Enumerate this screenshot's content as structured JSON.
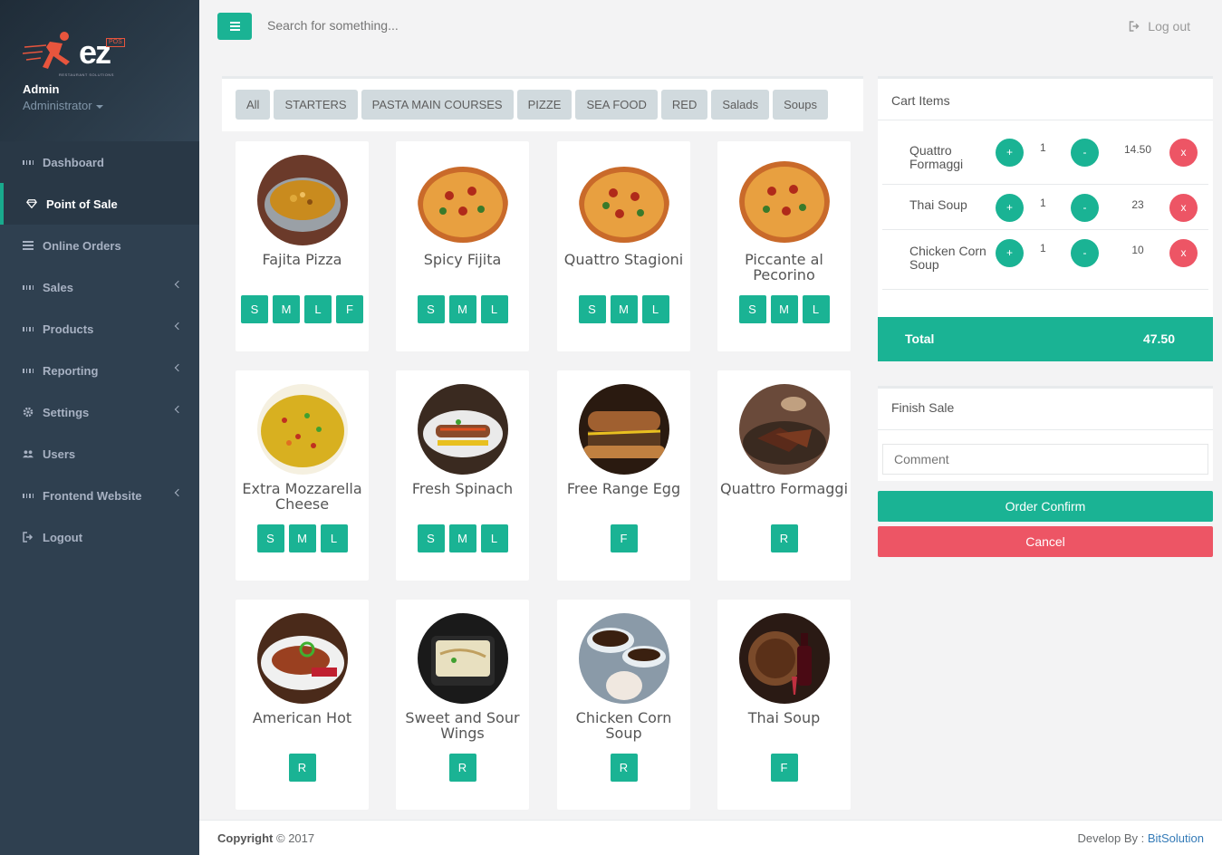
{
  "brand": {
    "logo_text": "ez",
    "logo_badge": "POS",
    "logo_tagline": "RESTAURANT SOLUTIONS"
  },
  "profile": {
    "name": "Admin",
    "role": "Administrator"
  },
  "sidebar": {
    "items": [
      {
        "label": "Dashboard",
        "icon": "grid-icon"
      },
      {
        "label": "Point of Sale",
        "icon": "diamond-icon"
      },
      {
        "label": "Online Orders",
        "icon": "list-icon"
      },
      {
        "label": "Sales",
        "icon": "grid-icon"
      },
      {
        "label": "Products",
        "icon": "grid-icon"
      },
      {
        "label": "Reporting",
        "icon": "grid-icon"
      },
      {
        "label": "Settings",
        "icon": "gear-icon"
      },
      {
        "label": "Users",
        "icon": "users-icon"
      },
      {
        "label": "Frontend Website",
        "icon": "grid-icon"
      },
      {
        "label": "Logout",
        "icon": "sign-out-icon"
      }
    ]
  },
  "topbar": {
    "search_placeholder": "Search for something...",
    "logout_label": "Log out"
  },
  "categories": [
    "All",
    "STARTERS",
    "PASTA MAIN COURSES",
    "PIZZE",
    "SEA FOOD",
    "RED",
    "Salads",
    "Soups"
  ],
  "products": [
    {
      "name": "Fajita Pizza",
      "sizes": [
        "S",
        "M",
        "L",
        "F"
      ]
    },
    {
      "name": "Spicy Fijita",
      "sizes": [
        "S",
        "M",
        "L"
      ]
    },
    {
      "name": "Quattro Stagioni",
      "sizes": [
        "S",
        "M",
        "L"
      ]
    },
    {
      "name": "Piccante al Pecorino",
      "sizes": [
        "S",
        "M",
        "L"
      ]
    },
    {
      "name": "Extra Mozzarella Cheese",
      "sizes": [
        "S",
        "M",
        "L"
      ]
    },
    {
      "name": "Fresh Spinach",
      "sizes": [
        "S",
        "M",
        "L"
      ]
    },
    {
      "name": "Free Range Egg",
      "sizes": [
        "F"
      ]
    },
    {
      "name": "Quattro Formaggi",
      "sizes": [
        "R"
      ]
    },
    {
      "name": "American Hot",
      "sizes": [
        "R"
      ]
    },
    {
      "name": "Sweet and Sour Wings",
      "sizes": [
        "R"
      ]
    },
    {
      "name": "Chicken Corn Soup",
      "sizes": [
        "R"
      ]
    },
    {
      "name": "Thai Soup",
      "sizes": [
        "F"
      ]
    }
  ],
  "cart": {
    "title": "Cart Items",
    "plus": "+",
    "minus": "-",
    "remove": "x",
    "items": [
      {
        "name": "Quattro Formaggi",
        "qty": "1",
        "price": "14.50"
      },
      {
        "name": "Thai Soup",
        "qty": "1",
        "price": "23"
      },
      {
        "name": "Chicken Corn Soup",
        "qty": "1",
        "price": "10"
      }
    ],
    "total_label": "Total",
    "total_value": "47.50"
  },
  "finish": {
    "title": "Finish Sale",
    "comment_placeholder": "Comment",
    "confirm_label": "Order Confirm",
    "cancel_label": "Cancel"
  },
  "footer": {
    "copyright_bold": "Copyright",
    "copyright_rest": " © 2017",
    "dev_label": "Develop By : ",
    "dev_link": "BitSolution"
  },
  "colors": {
    "sidebar": "#2f4050",
    "accent": "#1ab394",
    "danger": "#ed5565"
  }
}
